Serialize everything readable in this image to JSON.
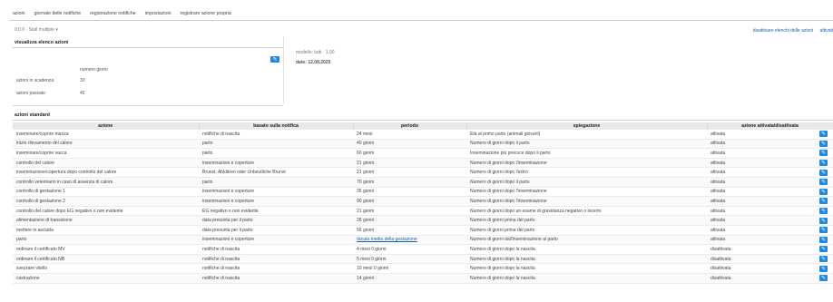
{
  "tabs": [
    "azioni",
    "giornale delle notifiche",
    "registrazione notifiche",
    "impostazioni",
    "registrare azione propria"
  ],
  "selector": "0.0.0 · Stall multiple",
  "selector_arrow": "▾",
  "toplinks": [
    "disattivare elenchi delle azioni",
    "attivati"
  ],
  "panel": {
    "title": "visualizza elenco azioni",
    "column_header": "numero giorni",
    "rows": [
      {
        "label": "azioni in scadenza",
        "value": "33"
      },
      {
        "label": "azioni passate",
        "value": "45"
      }
    ],
    "meta_line1": "modello: tutti · 1.00",
    "meta_line2": "date: 12.08.2025"
  },
  "standard": {
    "title": "azioni standard",
    "headers": [
      "azione",
      "basato sulla notifica",
      "periodo",
      "spiegazione",
      "azione attivata/disattivata"
    ],
    "rows": [
      [
        "inseminare/coprire manza",
        "notifiche di nascita",
        "24 mesi",
        "Età al primo parto (animali giovani)",
        "attivata"
      ],
      [
        "inizio rilevamento del calore",
        "parto",
        "40 giorni",
        "Numero di giorni dopo il parto",
        "attivata"
      ],
      [
        "inseminare/coprire vacca",
        "parto",
        "60 giorni",
        "Inseminazione più precoce dopo il parto",
        "attivata"
      ],
      [
        "controllo del calore",
        "inseminazioni e coperture",
        "21 giorni",
        "Numero di giorni dopo l'inseminazione",
        "attivata"
      ],
      [
        "inseminazione/copertura dopo controllo del calore",
        "Brunst, Abklären oder Unbeutliche Brunst",
        "21 giorni",
        "Numero di giorni dopo l'estro",
        "attivata"
      ],
      [
        "controllo veterinario in caso di assenza di calore",
        "parto",
        "70 giorni",
        "Numero di giorni dopo il parto",
        "attivata"
      ],
      [
        "controllo di gestazione 1",
        "inseminazioni e coperture",
        "35 giorni",
        "Numero di giorni dopo l'inseminazione",
        "attivata"
      ],
      [
        "controllo di gestazione 2",
        "inseminazioni e coperture",
        "90 giorni",
        "Numero di giorni dopo l'inseminazione",
        "attivata"
      ],
      [
        "controllo del calore dopo EG negativo o non evidente",
        "EG negativo o non evidente",
        "21 giorni",
        "Numero di giorni dopo un esame di gravidanza negativo o incerto",
        "attivata"
      ],
      [
        "alimentazione di transizione",
        "data presunta per il parto",
        "28 giorni",
        "Numero di giorni prima del parto",
        "attivata"
      ],
      [
        "mettere in asciutta",
        "data presunta per il parto",
        "56 giorni",
        "Numero di giorni prima del parto",
        "attivata"
      ],
      [
        "parto",
        "inseminazioni e coperture",
        "durata media della gestazione",
        "Numero di giorni dall'inseminazione al parto",
        "attivata"
      ],
      [
        "ordinare il certificato MV",
        "notifiche di nascita",
        "4 mesi 0 giorni",
        "Numero di giorni dopo la nascita",
        "disattivata"
      ],
      [
        "ordinare il certificato NB",
        "notifiche di nascita",
        "5 mesi 0 giorni",
        "Numero di giorni dopo la nascita",
        "disattivata"
      ],
      [
        "svezzare vitello",
        "notifiche di nascita",
        "10 mesi 0 giorni",
        "Numero di giorni dopo la nascita",
        "disattivata"
      ],
      [
        "castrazione",
        "notifiche di nascita",
        "14 giorni",
        "Numero di giorni dopo la nascita",
        "disattivata"
      ]
    ],
    "link_row_index": 11
  },
  "icons": {
    "edit": "pencil-icon"
  },
  "colors": {
    "accent": "#1e88e5",
    "link": "#1a5fb4",
    "header_bg": "#e9e9e9"
  }
}
